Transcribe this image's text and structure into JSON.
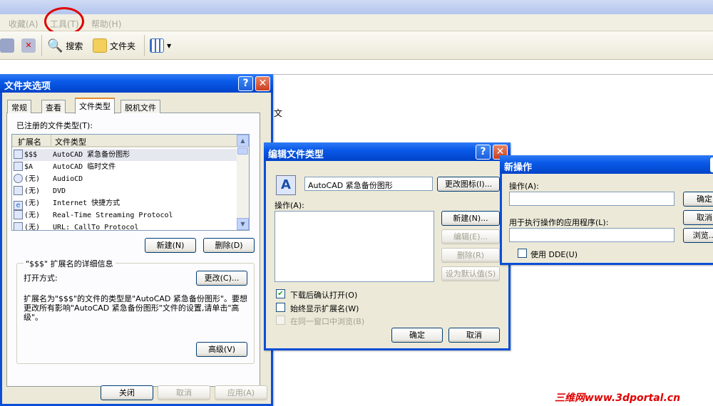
{
  "menu": {
    "items": [
      "收藏(A)",
      "工具(T)",
      "帮助(H)"
    ]
  },
  "toolbar": {
    "search": "搜索",
    "folders": "文件夹"
  },
  "stray_text": "文",
  "folder_options": {
    "title": "文件夹选项",
    "tabs": [
      "常规",
      "查看",
      "文件类型",
      "脱机文件"
    ],
    "registered_label": "已注册的文件类型(T):",
    "columns": [
      "扩展名",
      "文件类型"
    ],
    "rows": [
      {
        "ext": "$$$",
        "type": "AutoCAD 紧急备份图形"
      },
      {
        "ext": "$A",
        "type": "AutoCAD 临时文件"
      },
      {
        "ext": "(无)",
        "type": "AudioCD"
      },
      {
        "ext": "(无)",
        "type": "DVD"
      },
      {
        "ext": "(无)",
        "type": "Internet 快捷方式"
      },
      {
        "ext": "(无)",
        "type": "Real-Time Streaming Protocol"
      },
      {
        "ext": "(无)",
        "type": "URL: CallTo Protocol"
      }
    ],
    "new_button": "新建(N)",
    "delete_button": "删除(D)",
    "details_title": "\"$$$\" 扩展名的详细信息",
    "open_with_label": "打开方式:",
    "change_button": "更改(C)...",
    "description": "扩展名为\"$$$\"的文件的类型是\"AutoCAD 紧急备份图形\"。要想更改所有影响\"AutoCAD 紧急备份图形\"文件的设置,请单击\"高级\"。",
    "advanced_button": "高级(V)",
    "close_button": "关闭",
    "cancel_button": "取消",
    "apply_button": "应用(A)"
  },
  "edit_type": {
    "title": "编辑文件类型",
    "type_name": "AutoCAD 紧急备份图形",
    "change_icon_button": "更改图标(I)...",
    "actions_label": "操作(A):",
    "new_button": "新建(N)...",
    "edit_button": "编辑(E)...",
    "delete_button": "删除(R)",
    "default_button": "设为默认值(S)",
    "confirm_open_label": "下载后确认打开(O)",
    "always_show_ext_label": "始终显示扩展名(W)",
    "browse_same_window_label": "在同一窗口中浏览(B)",
    "ok_button": "确定",
    "cancel_button": "取消"
  },
  "new_action": {
    "title": "新操作",
    "action_label": "操作(A):",
    "app_label": "用于执行操作的应用程序(L):",
    "use_dde_label": "使用 DDE(U)",
    "ok_button": "确定",
    "cancel_button": "取消",
    "browse_button": "浏览..."
  },
  "watermark": "三维网www.3dportal.cn"
}
